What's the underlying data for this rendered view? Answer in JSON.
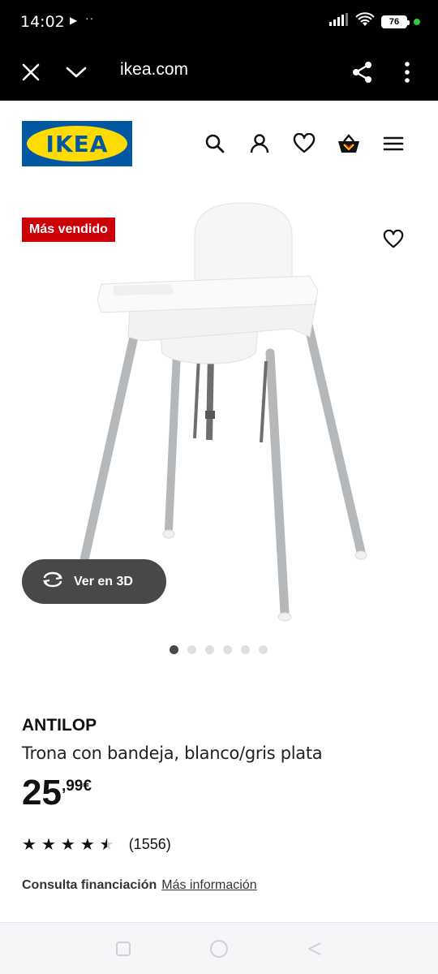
{
  "status_bar": {
    "time": "14:02",
    "battery": "76",
    "icons": [
      "play-icon",
      "more-dots-icon",
      "signal-icon",
      "wifi-icon",
      "battery-icon",
      "green-dot"
    ]
  },
  "browser": {
    "url": "ikea.com",
    "icons": [
      "close-icon",
      "chevron-down-icon",
      "share-icon",
      "kebab-menu-icon"
    ]
  },
  "header": {
    "logo_text": "IKEA",
    "icons": [
      "search-icon",
      "user-icon",
      "heart-icon",
      "shopping-bag-icon",
      "hamburger-menu-icon"
    ]
  },
  "product_image": {
    "badge": "Más vendido",
    "view_3d_label": "Ver en 3D",
    "carousel": {
      "count": 6,
      "active": 1
    }
  },
  "product": {
    "brand": "ANTILOP",
    "description": "Trona con bandeja, blanco/gris plata",
    "price_integer": "25",
    "price_decimal": ",99€",
    "rating": 4.5,
    "rating_count": "(1556)",
    "financing_label": "Consulta financiación",
    "financing_link": "Más información"
  },
  "colors": {
    "ikea_blue": "#0058a3",
    "ikea_yellow": "#ffdb00",
    "badge_red": "#cc0008",
    "pill_gray": "#484848"
  }
}
